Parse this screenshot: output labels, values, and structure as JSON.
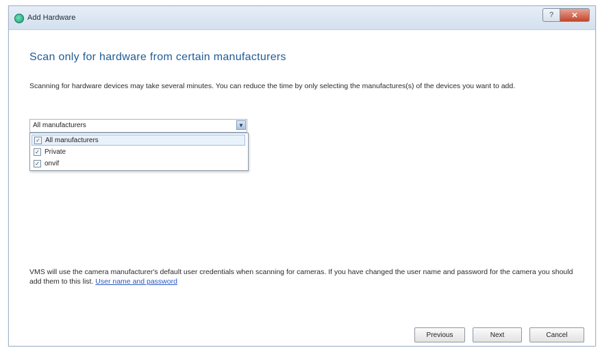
{
  "window": {
    "title": "Add Hardware",
    "help_glyph": "?",
    "close_glyph": "✕"
  },
  "heading": "Scan only for hardware from certain manufacturers",
  "description": "Scanning for hardware devices may take several minutes. You can reduce the time by only selecting the manufactures(s) of the devices you want to add.",
  "manufacturers": {
    "selected_value": "All manufacturers",
    "arrow_glyph": "▼",
    "options": [
      {
        "label": "All manufacturers",
        "checked": true,
        "check_glyph": "✓"
      },
      {
        "label": "Private",
        "checked": true,
        "check_glyph": "✓"
      },
      {
        "label": "onvif",
        "checked": true,
        "check_glyph": "✓"
      }
    ]
  },
  "note": {
    "text": "VMS will use the camera manufacturer's default user credentials when scanning for cameras. If you have changed the user name and password for the camera you should add them to this list. ",
    "link": "User name and password"
  },
  "buttons": {
    "previous": "Previous",
    "next": "Next",
    "cancel": "Cancel"
  }
}
